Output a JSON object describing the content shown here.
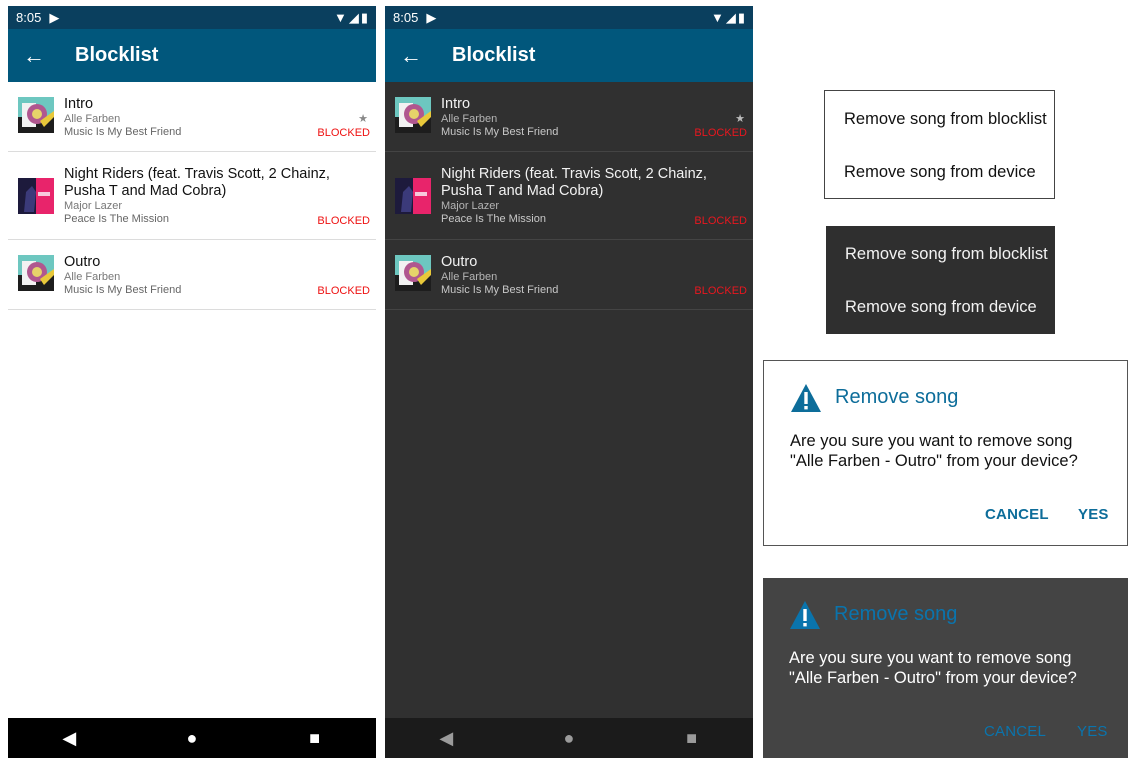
{
  "status_bar": {
    "time": "8:05"
  },
  "app_bar": {
    "back_glyph": "←",
    "title": "Blocklist"
  },
  "songs": [
    {
      "title": "Intro",
      "artist": "Alle Farben",
      "album": "Music Is My Best Friend",
      "badge": "BLOCKED",
      "starred": true,
      "cover": "music-is-my-best-friend-cover"
    },
    {
      "title": "Night Riders (feat. Travis Scott, 2 Chainz, Pusha T and Mad Cobra)",
      "artist": "Major Lazer",
      "album": "Peace Is The Mission",
      "badge": "BLOCKED",
      "starred": false,
      "cover": "peace-is-the-mission-cover"
    },
    {
      "title": "Outro",
      "artist": "Alle Farben",
      "album": "Music Is My Best Friend",
      "badge": "BLOCKED",
      "starred": false,
      "cover": "music-is-my-best-friend-cover"
    }
  ],
  "star_glyph": "★",
  "nav": {
    "back": "◀",
    "home": "●",
    "recents": "■"
  },
  "menu": {
    "item1": "Remove song from blocklist",
    "item2": "Remove song from device"
  },
  "dialog": {
    "title": "Remove song",
    "message": "Are you sure you want to remove song \"Alle Farben - Outro\"  from your device?",
    "cancel": "CANCEL",
    "yes": "YES"
  },
  "colors": {
    "status_bar": "#0a3f5e",
    "app_bar": "#01577c",
    "blocked": "#ee1111",
    "dialog_accent": "#0d6d9a",
    "dark_background": "#303030"
  }
}
